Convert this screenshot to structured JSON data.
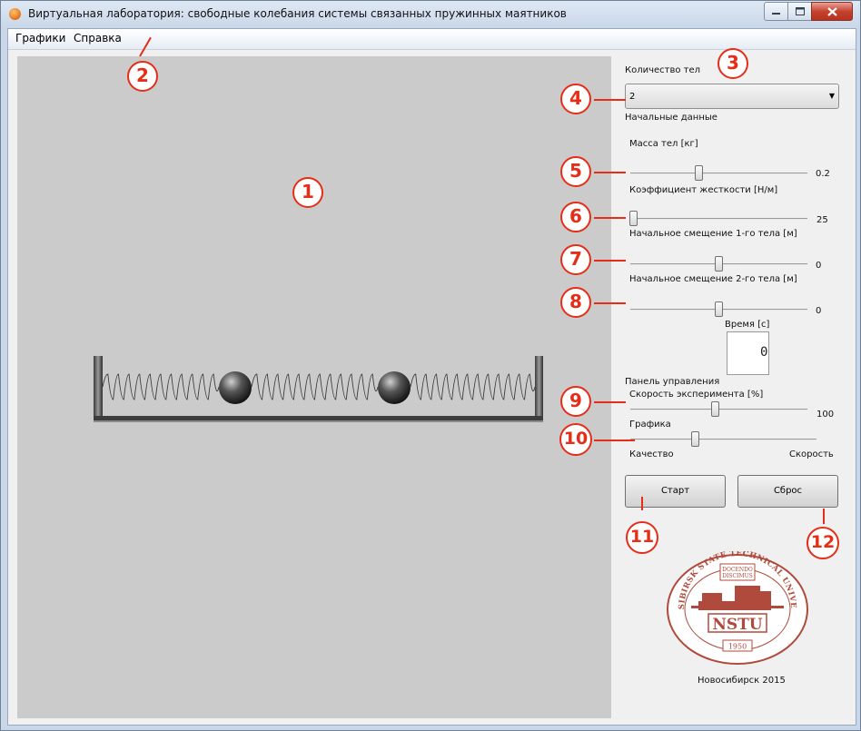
{
  "window": {
    "title": "Виртуальная лаборатория: свободные колебания системы связанных пружинных маятников"
  },
  "menu": {
    "items": [
      "Графики",
      "Справка"
    ]
  },
  "panel": {
    "count_label": "Количество тел",
    "count_value": "2",
    "initial_data_label": "Начальные данные",
    "mass_label": "Масса тел [кг]",
    "mass_value": "0.2",
    "mass_fraction": 0.39,
    "stiffness_label": "Коэффициент жесткости [Н/м]",
    "stiffness_value": "25",
    "stiffness_fraction": 0.02,
    "disp1_label": "Начальное смещение 1-го тела [м]",
    "disp1_value": "0",
    "disp1_fraction": 0.5,
    "disp2_label": "Начальное смещение 2-го тела [м]",
    "disp2_value": "0",
    "disp2_fraction": 0.5,
    "time_label": "Время [с]",
    "time_value": "0",
    "control_panel_label": "Панель управления",
    "speed_label": "Скорость эксперимента [%]",
    "speed_value": "100",
    "speed_fraction": 0.48,
    "graphics_label": "Графика",
    "graphics_fraction": 0.35,
    "quality_label": "Качество",
    "speed_end_label": "Скорость",
    "start_button": "Старт",
    "reset_button": "Сброс",
    "footer": "Новосибирск 2015"
  },
  "logo": {
    "ring_text": "NOVOSIBIRSK STATE TECHNICAL UNIVERSITY",
    "motto_top": "DOCENDO",
    "motto_bottom": "DISCIMUS",
    "abbrev": "NSTU",
    "year": "1950",
    "color": "#b04a3c"
  },
  "callouts": [
    "1",
    "2",
    "3",
    "4",
    "5",
    "6",
    "7",
    "8",
    "9",
    "10",
    "11",
    "12"
  ],
  "colors": {
    "accent": "#e52d18",
    "canvas_bg": "#cbcbcb"
  }
}
